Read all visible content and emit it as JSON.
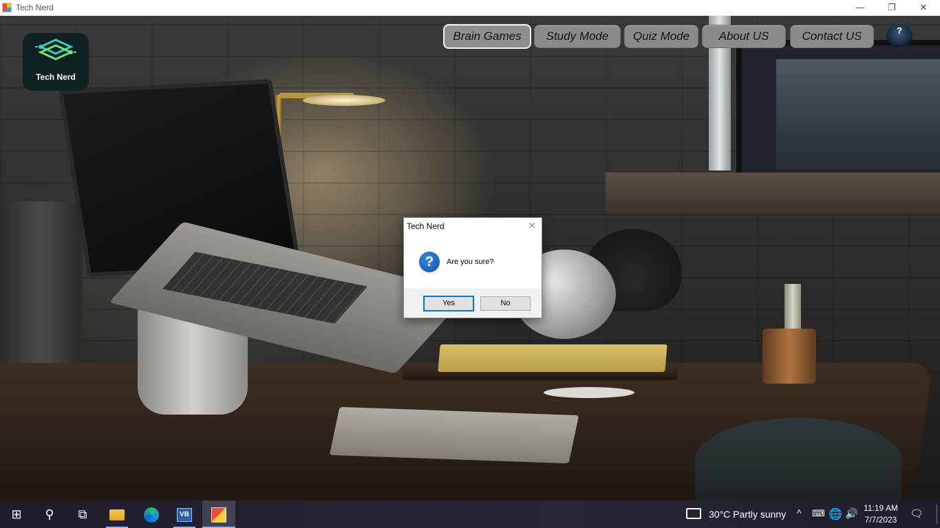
{
  "window": {
    "title": "Tech Nerd",
    "minimize_glyph": "—",
    "maximize_glyph": "❐",
    "close_glyph": "✕"
  },
  "logo": {
    "text": "Tech Nerd"
  },
  "nav": {
    "items": [
      {
        "label": "Brain Games",
        "selected": true
      },
      {
        "label": "Study Mode",
        "selected": false
      },
      {
        "label": "Quiz Mode",
        "selected": false
      },
      {
        "label": "About US",
        "selected": false
      },
      {
        "label": "Contact US",
        "selected": false
      }
    ],
    "help_glyph": "?"
  },
  "dialog": {
    "title": "Tech Nerd",
    "message": "Are you sure?",
    "icon_glyph": "?",
    "close_glyph": "✕",
    "yes_label": "Yes",
    "no_label": "No"
  },
  "taskbar": {
    "icons": [
      "windows-start-icon",
      "search-icon",
      "task-view-icon",
      "file-explorer-icon",
      "edge-icon",
      "visual-basic-icon",
      "tech-nerd-app-icon"
    ],
    "start_glyph": "⊞",
    "search_glyph": "⚲",
    "taskview_glyph": "⧉",
    "vb_text": "VB",
    "weather": "30°C  Partly sunny",
    "chevron_glyph": "^",
    "ime_glyph": "⌨",
    "globe_glyph": "🌐",
    "volume_glyph": "🔊",
    "time": "11:19 AM",
    "date": "7/7/2023",
    "notify_glyph": "🗨"
  },
  "colors": {
    "accent": "#0078d7",
    "nav_button": "#8a8a8a",
    "taskbar": "#242130"
  }
}
